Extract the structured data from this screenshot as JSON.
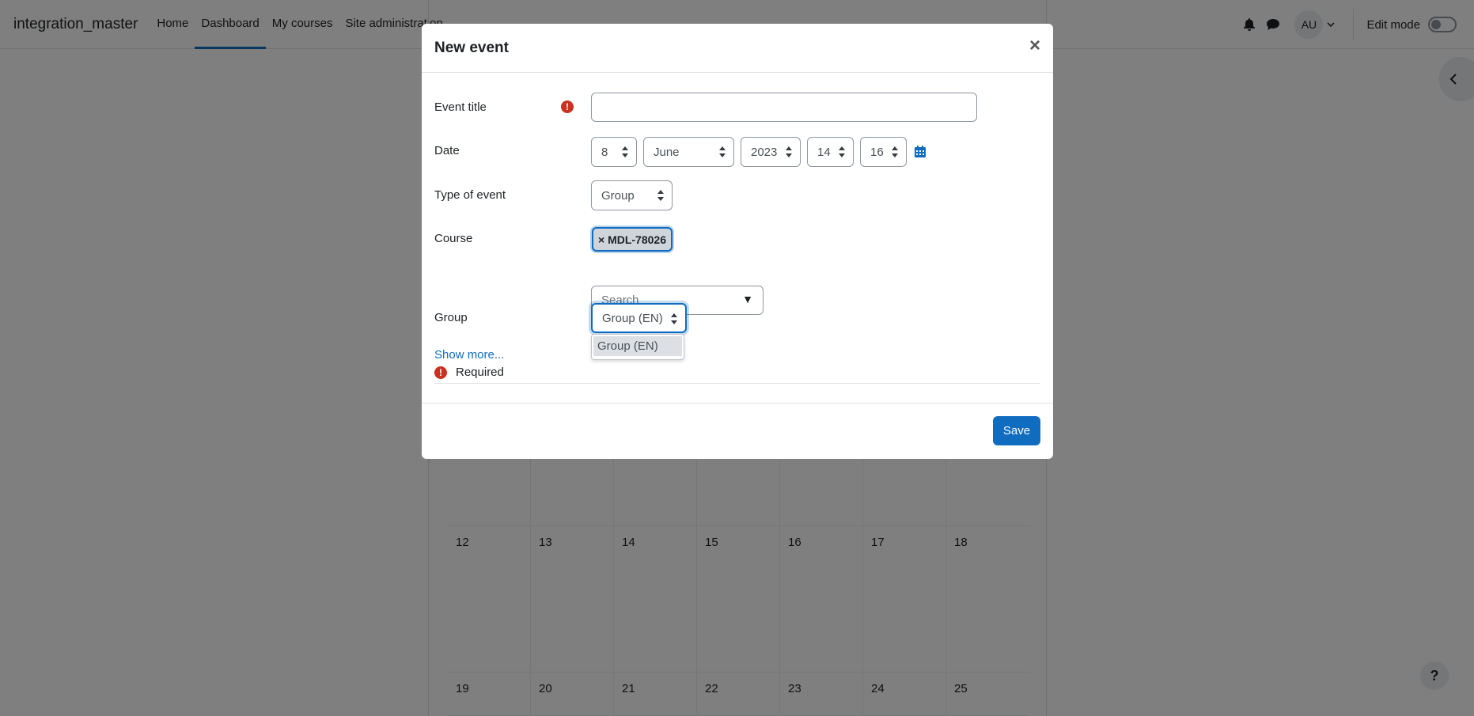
{
  "navbar": {
    "brand": "integration_master",
    "items": [
      "Home",
      "Dashboard",
      "My courses",
      "Site administration"
    ],
    "avatar": "AU",
    "edit_mode_label": "Edit mode"
  },
  "calendar": {
    "weeks": [
      [
        "12",
        "13",
        "14",
        "15",
        "16",
        "17",
        "18"
      ],
      [
        "19",
        "20",
        "21",
        "22",
        "23",
        "24",
        "25"
      ]
    ]
  },
  "help": "?",
  "modal": {
    "title": "New event",
    "close": "×",
    "event_title_label": "Event title",
    "event_title_value": "",
    "date_label": "Date",
    "date": {
      "day": "8",
      "month": "June",
      "year": "2023",
      "hour": "14",
      "minute": "16"
    },
    "type_label": "Type of event",
    "type_value": "Group",
    "course_label": "Course",
    "course_chip": "× MDL-78026",
    "course_search_placeholder": "Search",
    "course_search_arrow": "▼",
    "group_label": "Group",
    "group_value": "Group (EN)",
    "group_options": [
      "Group (EN)"
    ],
    "show_more": "Show more...",
    "required_note": "Required",
    "required_icon": "!",
    "save_label": "Save"
  },
  "colors": {
    "primary": "#0f6cbf",
    "danger": "#ca3120"
  }
}
